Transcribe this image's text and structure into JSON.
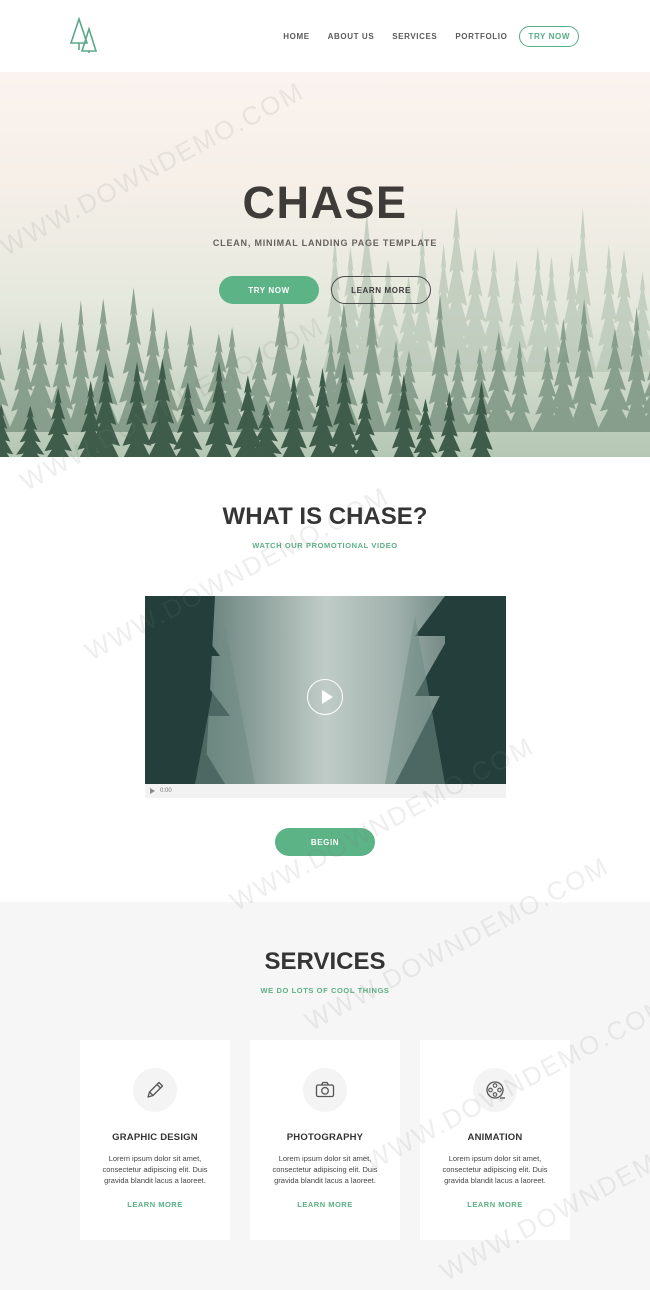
{
  "nav": {
    "links": [
      "HOME",
      "ABOUT US",
      "SERVICES",
      "PORTFOLIO"
    ],
    "try_label": "TRY NOW"
  },
  "hero": {
    "title": "CHASE",
    "subtitle": "CLEAN, MINIMAL LANDING PAGE TEMPLATE",
    "primary_button": "TRY NOW",
    "secondary_button": "LEARN MORE"
  },
  "what": {
    "title": "WHAT IS CHASE?",
    "subtitle": "WATCH OUR PROMOTIONAL VIDEO",
    "video_time": "0:00",
    "begin_button": "BEGIN"
  },
  "services": {
    "title": "SERVICES",
    "subtitle": "WE DO LOTS OF COOL THINGS",
    "items": [
      {
        "icon": "pencil-icon",
        "title": "GRAPHIC DESIGN",
        "text": "Lorem ipsum dolor sit amet, consectetur adipiscing elit. Duis gravida blandit lacus a laoreet.",
        "link": "LEARN MORE"
      },
      {
        "icon": "camera-icon",
        "title": "PHOTOGRAPHY",
        "text": "Lorem ipsum dolor sit amet, consectetur adipiscing elit. Duis gravida blandit lacus a laoreet.",
        "link": "LEARN MORE"
      },
      {
        "icon": "film-reel-icon",
        "title": "ANIMATION",
        "text": "Lorem ipsum dolor sit amet, consectetur adipiscing elit. Duis gravida blandit lacus a laoreet.",
        "link": "LEARN MORE"
      }
    ]
  },
  "watermark": "WWW.DOWNDEMO.COM",
  "colors": {
    "accent": "#5cb386",
    "text_dark": "#353535",
    "services_bg": "#f6f6f6"
  }
}
